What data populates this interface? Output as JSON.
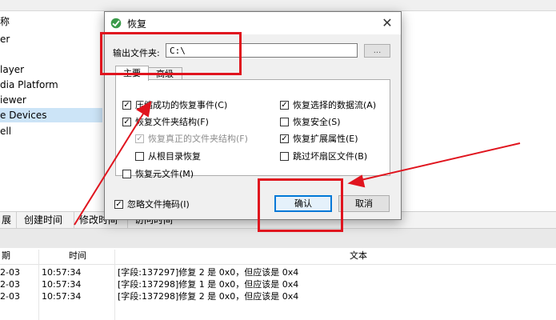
{
  "background": {
    "tree_items": [
      "称",
      "er",
      "layer",
      "dia Platform",
      "iewer",
      "e Devices",
      "ell"
    ],
    "columns": [
      "展",
      "创建时间",
      "修改时间",
      "访问时间"
    ],
    "log": {
      "headers": {
        "date": "期",
        "time": "时间",
        "text": "文本"
      },
      "rows": [
        {
          "date": "2-03",
          "time": "10:57:34",
          "text": "[字段:137297]修复 2 是 0x0，但应该是 0x4"
        },
        {
          "date": "2-03",
          "time": "10:57:34",
          "text": "[字段:137298]修复 1 是 0x0，但应该是 0x4"
        },
        {
          "date": "2-03",
          "time": "10:57:34",
          "text": "[字段:137298]修复 2 是 0x0，但应该是 0x4"
        }
      ]
    }
  },
  "dialog": {
    "title": "恢复",
    "output_label": "输出文件夹:",
    "output_value": "C:\\",
    "browse_label": "...",
    "tabs": [
      {
        "label": "主要",
        "active": true
      },
      {
        "label": "高级",
        "active": false
      }
    ],
    "options_left": [
      {
        "label": "压缩成功的恢复事件(C)",
        "checked": true,
        "disabled": false
      },
      {
        "label": "恢复文件夹结构(F)",
        "checked": true,
        "disabled": false
      },
      {
        "label": "恢复真正的文件夹结构(F)",
        "checked": true,
        "disabled": true
      },
      {
        "label": "从根目录恢复",
        "checked": false,
        "disabled": false
      },
      {
        "label": "恢复元文件(M)",
        "checked": false,
        "disabled": false
      }
    ],
    "options_right": [
      {
        "label": "恢复选择的数据流(A)",
        "checked": true,
        "disabled": false
      },
      {
        "label": "恢复安全(S)",
        "checked": false,
        "disabled": false
      },
      {
        "label": "恢复扩展属性(E)",
        "checked": true,
        "disabled": false
      },
      {
        "label": "跳过坏扇区文件(B)",
        "checked": false,
        "disabled": false
      }
    ],
    "ignore_label": "忽略文件掩码(I)",
    "ignore_checked": true,
    "ok_label": "确认",
    "cancel_label": "取消"
  },
  "colors": {
    "annotation": "#e0141e",
    "accent": "#0078d7",
    "selection": "#cce4f7"
  }
}
